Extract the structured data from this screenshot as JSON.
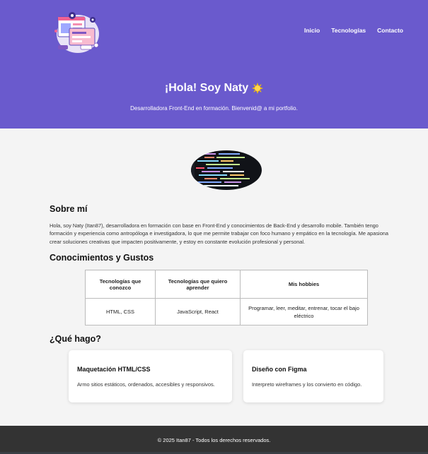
{
  "nav": {
    "items": [
      "Inicio",
      "Tecnologías",
      "Contacto"
    ]
  },
  "hero": {
    "title": "¡Hola! Soy Naty",
    "emoji": "sun-emoji",
    "subtitle": "Desarrolladora Front-End en formación. Bienvenid@ a mi portfolio."
  },
  "about": {
    "heading": "Sobre mí",
    "text": "Hola, soy Naty (Itan87), desarrolladora en formación con base en Front-End y conocimientos de Back-End y desarrollo mobile. También tengo formación y experiencia como antropóloga e investigadora, lo que me permite trabajar con foco humano y empático en la tecnología. Me apasiona crear soluciones creativas que impacten positivamente, y estoy en constante evolución profesional y personal."
  },
  "skills": {
    "heading": "Conocimientos y Gustos",
    "headers": [
      "Tecnologías que conozco",
      "Tecnologías que quiero aprender",
      "Mis hobbies"
    ],
    "row": [
      "HTML, CSS",
      "JavaScript, React",
      "Programar, leer, meditar, entrenar, tocar el bajo eléctrico"
    ]
  },
  "services": {
    "heading": "¿Qué hago?",
    "cards": [
      {
        "title": "Maquetación HTML/CSS",
        "text": "Armo sitios estáticos, ordenados, accesibles y responsivos."
      },
      {
        "title": "Diseño con Figma",
        "text": "Interpreto wireframes y los convierto en código."
      }
    ]
  },
  "footer": {
    "text": "© 2025 Itan87 - Todos los derechos reservados."
  },
  "colors": {
    "header_bg": "#6a5acd",
    "footer_bg": "#333333",
    "page_bg": "#f4f4f4"
  }
}
